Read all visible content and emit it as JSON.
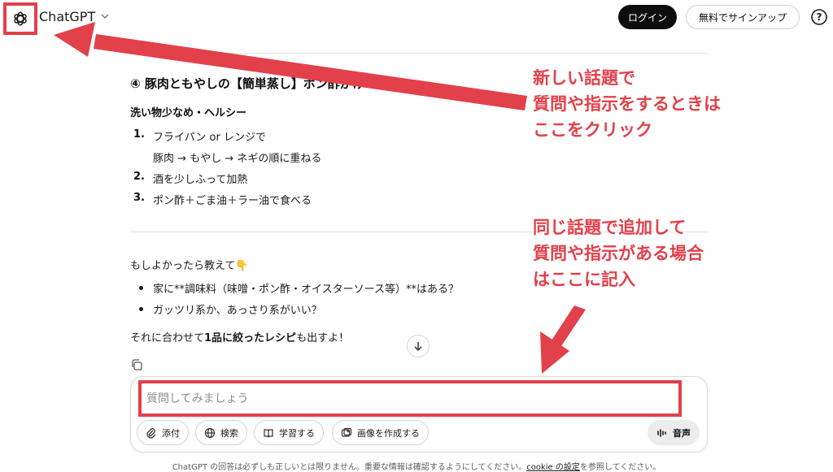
{
  "header": {
    "brand": "ChatGPT",
    "login_label": "ログイン",
    "signup_label": "無料でサインアップ"
  },
  "recipe": {
    "title": "④ 豚肉ともやしの【簡単蒸し】ポン酢がけ",
    "subtitle": "洗い物少なめ・ヘルシー",
    "steps": [
      {
        "num": "1.",
        "text": "フライパン or レンジで",
        "text2": "豚肉 → もやし → ネギの順に重ねる"
      },
      {
        "num": "2.",
        "text": "酒を少しふって加熱"
      },
      {
        "num": "3.",
        "text": "ポン酢＋ごま油＋ラー油で食べる"
      }
    ]
  },
  "followup": {
    "intro": "もしよかったら教えて👇",
    "bullets": [
      "家に**調味料（味噌・ポン酢・オイスターソース等）**はある？",
      "ガッツリ系か、あっさり系がいい？"
    ],
    "closing_pre": "それに合わせて",
    "closing_bold": "1品に絞ったレシピ",
    "closing_post": "も出すよ！"
  },
  "composer": {
    "placeholder": "質問してみましょう",
    "buttons": {
      "attach": "添付",
      "search": "検索",
      "study": "学習する",
      "image": "画像を作成する",
      "voice": "音声"
    }
  },
  "footer": {
    "pre": "ChatGPT の回答は必ずしも正しいとは限りません。重要な情報は確認するようにしてください。",
    "link": "cookie の設定",
    "post": "を参照してください。"
  },
  "annotations": {
    "top": [
      "新しい話題で",
      "質問や指示をするときは",
      "ここをクリック"
    ],
    "bottom": [
      "同じ話題で追加して",
      "質問や指示がある場合",
      "はここに記入"
    ]
  },
  "colors": {
    "annotation": "#e2404a",
    "login_bg": "#0d0d0d"
  }
}
